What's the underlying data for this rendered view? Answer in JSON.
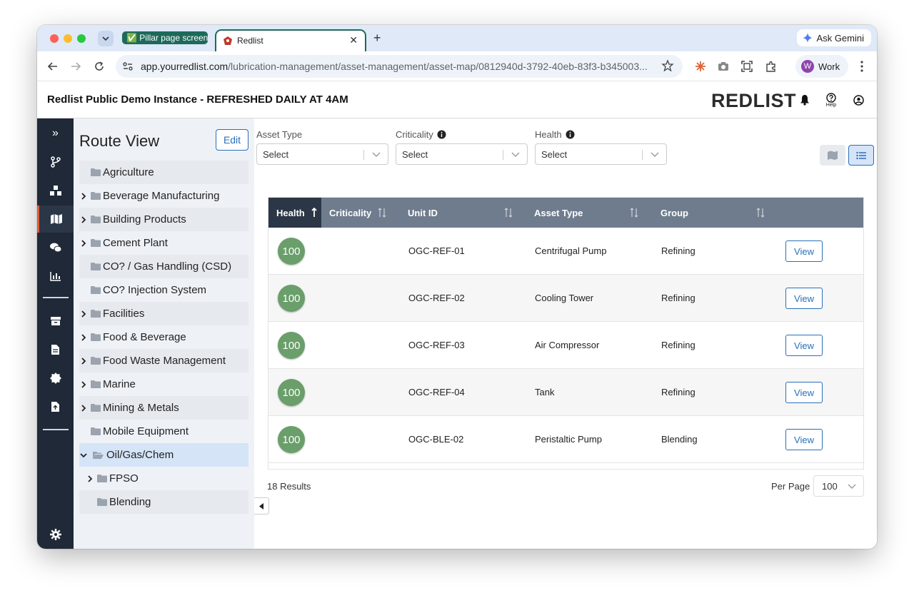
{
  "browser": {
    "tab_group_label": "Pillar page screen",
    "active_tab_title": "Redlist",
    "url_host": "app.yourredlist.com",
    "url_path": "/lubrication-management/asset-management/asset-map/0812940d-3792-40eb-83f3-b345003...",
    "ask_gemini": "Ask Gemini",
    "profile_initial": "W",
    "profile_label": "Work"
  },
  "header": {
    "title": "Redlist Public Demo Instance - REFRESHED DAILY AT 4AM",
    "logo": "REDLIST",
    "help_label": "Help"
  },
  "route": {
    "title": "Route View",
    "edit_label": "Edit",
    "items": [
      {
        "label": "Agriculture",
        "expandable": false,
        "level": 0
      },
      {
        "label": "Beverage Manufacturing",
        "expandable": true,
        "level": 0
      },
      {
        "label": "Building Products",
        "expandable": true,
        "level": 0
      },
      {
        "label": "Cement Plant",
        "expandable": true,
        "level": 0
      },
      {
        "label": "CO? / Gas Handling (CSD)",
        "expandable": false,
        "level": 0
      },
      {
        "label": "CO? Injection System",
        "expandable": false,
        "level": 0
      },
      {
        "label": "Facilities",
        "expandable": true,
        "level": 0
      },
      {
        "label": "Food & Beverage",
        "expandable": true,
        "level": 0
      },
      {
        "label": "Food Waste Management",
        "expandable": true,
        "level": 0
      },
      {
        "label": "Marine",
        "expandable": true,
        "level": 0
      },
      {
        "label": "Mining & Metals",
        "expandable": true,
        "level": 0
      },
      {
        "label": "Mobile Equipment",
        "expandable": false,
        "level": 0
      },
      {
        "label": "Oil/Gas/Chem",
        "expandable": true,
        "level": 0,
        "expanded": true
      },
      {
        "label": "FPSO",
        "expandable": true,
        "level": 1
      },
      {
        "label": "Blending",
        "expandable": false,
        "level": 1
      }
    ]
  },
  "filters": {
    "asset_type": {
      "label": "Asset Type",
      "value": "Select"
    },
    "criticality": {
      "label": "Criticality",
      "value": "Select"
    },
    "health": {
      "label": "Health",
      "value": "Select"
    }
  },
  "table": {
    "columns": [
      "Health",
      "Criticality",
      "Unit ID",
      "Asset Type",
      "Group"
    ],
    "rows": [
      {
        "health": "100",
        "criticality": "",
        "unit_id": "OGC-REF-01",
        "asset_type": "Centrifugal Pump",
        "group": "Refining",
        "action": "View"
      },
      {
        "health": "100",
        "criticality": "",
        "unit_id": "OGC-REF-02",
        "asset_type": "Cooling Tower",
        "group": "Refining",
        "action": "View"
      },
      {
        "health": "100",
        "criticality": "",
        "unit_id": "OGC-REF-03",
        "asset_type": "Air Compressor",
        "group": "Refining",
        "action": "View"
      },
      {
        "health": "100",
        "criticality": "",
        "unit_id": "OGC-REF-04",
        "asset_type": "Tank",
        "group": "Refining",
        "action": "View"
      },
      {
        "health": "100",
        "criticality": "",
        "unit_id": "OGC-BLE-02",
        "asset_type": "Peristaltic Pump",
        "group": "Blending",
        "action": "View"
      }
    ]
  },
  "footer": {
    "results": "18 Results",
    "per_page_label": "Per Page",
    "per_page_value": "100"
  },
  "colors": {
    "accent": "#2a6fb8",
    "nav_bg": "#1f2937",
    "health_green": "#6a9e6a",
    "table_header": "#6f7c8e",
    "active_marker": "#e05a3a"
  }
}
